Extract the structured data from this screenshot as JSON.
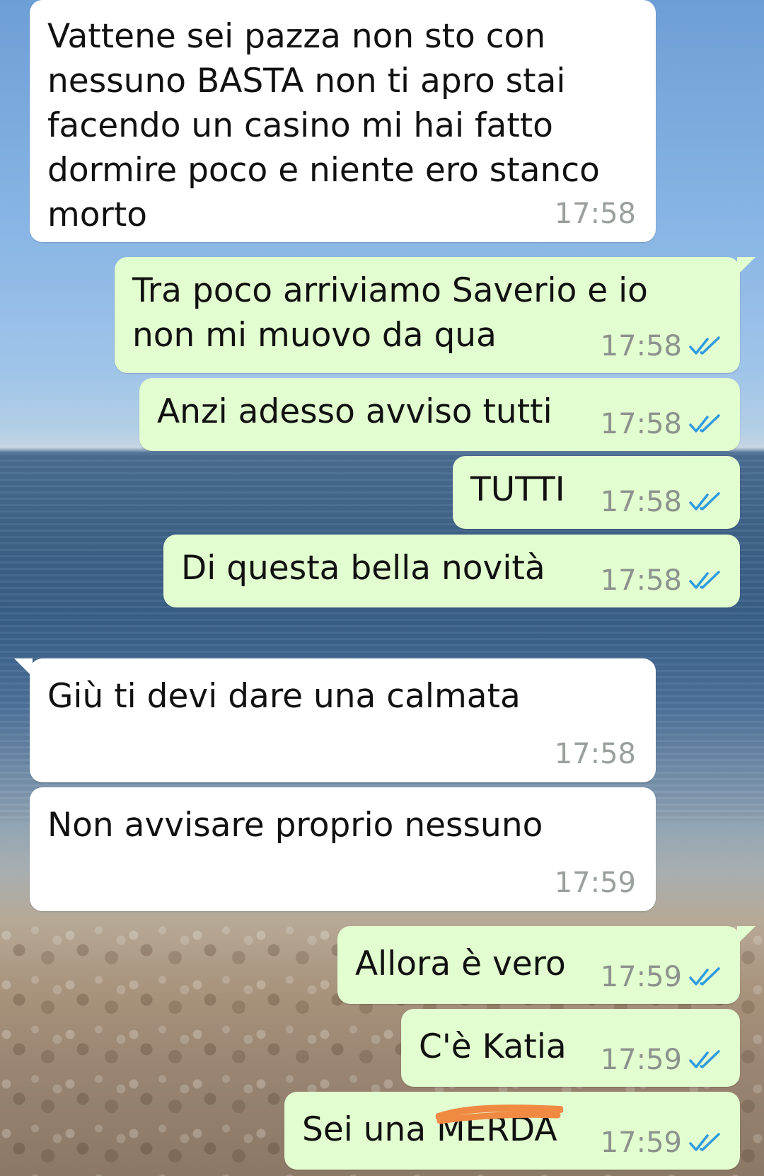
{
  "messages": [
    {
      "direction": "in",
      "text": "Vattene sei pazza non sto con\nnessuno BASTA non ti apro stai\nfacendo un casino mi hai fatto\ndormire poco e niente ero stanco\nmorto",
      "time": "17:58"
    },
    {
      "direction": "out",
      "text": "Tra poco arriviamo Saverio e io\nnon mi muovo da qua",
      "time": "17:58",
      "read": true
    },
    {
      "direction": "out",
      "text": "Anzi adesso avviso tutti",
      "time": "17:58",
      "read": true
    },
    {
      "direction": "out",
      "text": "TUTTI",
      "time": "17:58",
      "read": true
    },
    {
      "direction": "out",
      "text": "Di questa bella novità",
      "time": "17:58",
      "read": true
    },
    {
      "direction": "in",
      "text": "Giù ti devi dare una calmata",
      "time": "17:58"
    },
    {
      "direction": "in",
      "text": "Non avvisare proprio nessuno",
      "time": "17:59"
    },
    {
      "direction": "out",
      "text": "Allora è vero",
      "time": "17:59",
      "read": true
    },
    {
      "direction": "out",
      "text": "C'è Katia",
      "time": "17:59",
      "read": true
    },
    {
      "direction": "out",
      "text": "Sei una MERDA",
      "time": "17:59",
      "read": true,
      "redacted_word": "MERDA"
    }
  ],
  "colors": {
    "incoming_bubble": "#ffffff",
    "outgoing_bubble": "#e2fdcf",
    "read_ticks": "#2f9be0",
    "redaction_scribble": "#f08a43"
  },
  "icons": {
    "read_receipt": "double-check-icon"
  }
}
